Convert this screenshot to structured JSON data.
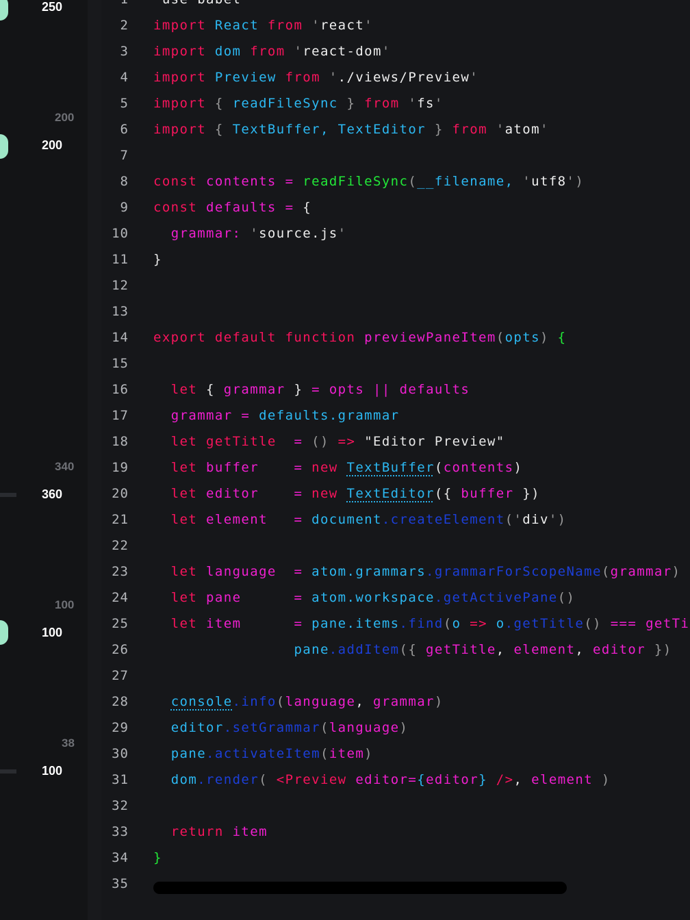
{
  "sidebar": {
    "values": [
      {
        "top": "250",
        "top_dim": ""
      },
      {
        "top": "200",
        "top_dim": "200"
      },
      {
        "top": "360",
        "top_dim": "340"
      },
      {
        "top": "100",
        "top_dim": "100"
      },
      {
        "top": "100",
        "top_dim": "38"
      }
    ]
  },
  "editor": {
    "lines": [
      {
        "n": "1",
        "tokens": [
          [
            "q",
            "'"
          ],
          [
            "str",
            "use babel"
          ],
          [
            "q",
            "'"
          ]
        ]
      },
      {
        "n": "2",
        "tokens": [
          [
            "kw",
            "import "
          ],
          [
            "cls",
            "React "
          ],
          [
            "kw",
            "from "
          ],
          [
            "q",
            "'"
          ],
          [
            "str",
            "react"
          ],
          [
            "q",
            "'"
          ]
        ]
      },
      {
        "n": "3",
        "tokens": [
          [
            "kw",
            "import "
          ],
          [
            "cls",
            "dom "
          ],
          [
            "kw",
            "from "
          ],
          [
            "q",
            "'"
          ],
          [
            "str",
            "react-dom"
          ],
          [
            "q",
            "'"
          ]
        ]
      },
      {
        "n": "4",
        "tokens": [
          [
            "kw",
            "import "
          ],
          [
            "cls",
            "Preview "
          ],
          [
            "kw",
            "from "
          ],
          [
            "q",
            "'"
          ],
          [
            "str",
            "./views/Preview"
          ],
          [
            "q",
            "'"
          ]
        ]
      },
      {
        "n": "5",
        "tokens": [
          [
            "kw",
            "import "
          ],
          [
            "dim",
            "{ "
          ],
          [
            "cls",
            "readFileSync "
          ],
          [
            "dim",
            "} "
          ],
          [
            "kw",
            "from "
          ],
          [
            "q",
            "'"
          ],
          [
            "str",
            "fs"
          ],
          [
            "q",
            "'"
          ]
        ]
      },
      {
        "n": "6",
        "tokens": [
          [
            "kw",
            "import "
          ],
          [
            "dim",
            "{ "
          ],
          [
            "cls",
            "TextBuffer, TextEditor "
          ],
          [
            "dim",
            "} "
          ],
          [
            "kw",
            "from "
          ],
          [
            "q",
            "'"
          ],
          [
            "str",
            "atom"
          ],
          [
            "q",
            "'"
          ]
        ]
      },
      {
        "n": "7",
        "tokens": []
      },
      {
        "n": "8",
        "tokens": [
          [
            "kw",
            "const "
          ],
          [
            "id",
            "contents "
          ],
          [
            "op",
            "= "
          ],
          [
            "fn",
            "readFileSync"
          ],
          [
            "dim",
            "("
          ],
          [
            "prop",
            "__filename, "
          ],
          [
            "q",
            "'"
          ],
          [
            "str",
            "utf8"
          ],
          [
            "q",
            "'"
          ],
          [
            "dim",
            ")"
          ]
        ]
      },
      {
        "n": "9",
        "tokens": [
          [
            "kw",
            "const "
          ],
          [
            "id",
            "defaults "
          ],
          [
            "op",
            "= "
          ],
          [
            "w",
            "{"
          ]
        ]
      },
      {
        "n": "10",
        "tokens": [
          [
            "w",
            "  "
          ],
          [
            "id",
            "grammar: "
          ],
          [
            "q",
            "'"
          ],
          [
            "str",
            "source.js"
          ],
          [
            "q",
            "'"
          ]
        ]
      },
      {
        "n": "11",
        "tokens": [
          [
            "w",
            "}"
          ]
        ]
      },
      {
        "n": "12",
        "tokens": []
      },
      {
        "n": "13",
        "tokens": []
      },
      {
        "n": "14",
        "tokens": [
          [
            "kw",
            "export default function "
          ],
          [
            "id",
            "previewPaneItem"
          ],
          [
            "dim",
            "("
          ],
          [
            "prop",
            "opts"
          ],
          [
            "dim",
            ") "
          ],
          [
            "fn",
            "{"
          ]
        ]
      },
      {
        "n": "15",
        "tokens": []
      },
      {
        "n": "16",
        "tokens": [
          [
            "w",
            "  "
          ],
          [
            "kw",
            "let "
          ],
          [
            "w",
            "{ "
          ],
          [
            "id",
            "grammar "
          ],
          [
            "w",
            "} "
          ],
          [
            "op",
            "= "
          ],
          [
            "id",
            "opts "
          ],
          [
            "op",
            "|| "
          ],
          [
            "id",
            "defaults"
          ]
        ]
      },
      {
        "n": "17",
        "tokens": [
          [
            "w",
            "  "
          ],
          [
            "id",
            "grammar "
          ],
          [
            "op",
            "= "
          ],
          [
            "prop",
            "defaults"
          ],
          [
            "prop",
            ".grammar"
          ]
        ]
      },
      {
        "n": "18",
        "tokens": [
          [
            "w",
            "  "
          ],
          [
            "kw",
            "let "
          ],
          [
            "kw",
            "getTitle  "
          ],
          [
            "op",
            "= "
          ],
          [
            "dim",
            "() "
          ],
          [
            "kw",
            "=> "
          ],
          [
            "w",
            "\"Editor Preview\""
          ]
        ]
      },
      {
        "n": "19",
        "tokens": [
          [
            "w",
            "  "
          ],
          [
            "kw",
            "let "
          ],
          [
            "id",
            "buffer    "
          ],
          [
            "op",
            "= "
          ],
          [
            "kw",
            "new "
          ],
          [
            "cls_u",
            "TextBuffer"
          ],
          [
            "w",
            "("
          ],
          [
            "id",
            "contents"
          ],
          [
            "w",
            ")"
          ]
        ]
      },
      {
        "n": "20",
        "tokens": [
          [
            "w",
            "  "
          ],
          [
            "kw",
            "let "
          ],
          [
            "id",
            "editor    "
          ],
          [
            "op",
            "= "
          ],
          [
            "kw",
            "new "
          ],
          [
            "cls_u",
            "TextEditor"
          ],
          [
            "w",
            "({ "
          ],
          [
            "id",
            "buffer "
          ],
          [
            "w",
            "})"
          ]
        ]
      },
      {
        "n": "21",
        "tokens": [
          [
            "w",
            "  "
          ],
          [
            "kw",
            "let "
          ],
          [
            "id",
            "element   "
          ],
          [
            "op",
            "= "
          ],
          [
            "prop",
            "document"
          ],
          [
            "meth",
            ".createElement"
          ],
          [
            "dim",
            "("
          ],
          [
            "q",
            "'"
          ],
          [
            "str",
            "div"
          ],
          [
            "q",
            "'"
          ],
          [
            "dim",
            ")"
          ]
        ]
      },
      {
        "n": "22",
        "tokens": []
      },
      {
        "n": "23",
        "tokens": [
          [
            "w",
            "  "
          ],
          [
            "kw",
            "let "
          ],
          [
            "id",
            "language  "
          ],
          [
            "op",
            "= "
          ],
          [
            "prop",
            "atom.grammars"
          ],
          [
            "meth",
            ".grammarForScopeName"
          ],
          [
            "dim",
            "("
          ],
          [
            "id",
            "grammar"
          ],
          [
            "dim",
            ")"
          ]
        ]
      },
      {
        "n": "24",
        "tokens": [
          [
            "w",
            "  "
          ],
          [
            "kw",
            "let "
          ],
          [
            "id",
            "pane      "
          ],
          [
            "op",
            "= "
          ],
          [
            "prop",
            "atom.workspace"
          ],
          [
            "meth",
            ".getActivePane"
          ],
          [
            "dim",
            "()"
          ]
        ]
      },
      {
        "n": "25",
        "tokens": [
          [
            "w",
            "  "
          ],
          [
            "kw",
            "let "
          ],
          [
            "id",
            "item      "
          ],
          [
            "op",
            "= "
          ],
          [
            "prop",
            "pane.items"
          ],
          [
            "meth",
            ".find"
          ],
          [
            "dim",
            "("
          ],
          [
            "prop",
            "o "
          ],
          [
            "kw",
            "=> "
          ],
          [
            "prop",
            "o"
          ],
          [
            "meth",
            ".getTitle"
          ],
          [
            "dim",
            "() "
          ],
          [
            "op",
            "=== "
          ],
          [
            "id",
            "getTitle"
          ],
          [
            "dim",
            "())"
          ]
        ]
      },
      {
        "n": "26",
        "tokens": [
          [
            "w",
            "                "
          ],
          [
            "prop",
            "pane"
          ],
          [
            "meth",
            ".addItem"
          ],
          [
            "dim",
            "({ "
          ],
          [
            "id",
            "getTitle"
          ],
          [
            "w",
            ", "
          ],
          [
            "id",
            "element"
          ],
          [
            "w",
            ", "
          ],
          [
            "id",
            "editor "
          ],
          [
            "dim",
            "})"
          ]
        ]
      },
      {
        "n": "27",
        "tokens": []
      },
      {
        "n": "28",
        "tokens": [
          [
            "w",
            "  "
          ],
          [
            "prop_u",
            "console"
          ],
          [
            "meth",
            ".info"
          ],
          [
            "dim",
            "("
          ],
          [
            "id",
            "language"
          ],
          [
            "w",
            ", "
          ],
          [
            "id",
            "grammar"
          ],
          [
            "dim",
            ")"
          ]
        ]
      },
      {
        "n": "29",
        "tokens": [
          [
            "w",
            "  "
          ],
          [
            "prop",
            "editor"
          ],
          [
            "meth",
            ".setGrammar"
          ],
          [
            "dim",
            "("
          ],
          [
            "id",
            "language"
          ],
          [
            "dim",
            ")"
          ]
        ]
      },
      {
        "n": "30",
        "tokens": [
          [
            "w",
            "  "
          ],
          [
            "prop",
            "pane"
          ],
          [
            "meth",
            ".activateItem"
          ],
          [
            "dim",
            "("
          ],
          [
            "id",
            "item"
          ],
          [
            "dim",
            ")"
          ]
        ]
      },
      {
        "n": "31",
        "tokens": [
          [
            "w",
            "  "
          ],
          [
            "prop",
            "dom"
          ],
          [
            "meth",
            ".render"
          ],
          [
            "dim",
            "( "
          ],
          [
            "kw",
            "<Preview "
          ],
          [
            "id",
            "editor="
          ],
          [
            "prop",
            "{"
          ],
          [
            "id",
            "editor"
          ],
          [
            "prop",
            "} "
          ],
          [
            "kw",
            "/>"
          ],
          [
            "w",
            ", "
          ],
          [
            "id",
            "element "
          ],
          [
            "dim",
            ")"
          ]
        ]
      },
      {
        "n": "32",
        "tokens": []
      },
      {
        "n": "33",
        "tokens": [
          [
            "w",
            "  "
          ],
          [
            "kw",
            "return "
          ],
          [
            "id",
            "item"
          ]
        ]
      },
      {
        "n": "34",
        "tokens": [
          [
            "fn",
            "}"
          ]
        ]
      },
      {
        "n": "35",
        "tokens": []
      }
    ]
  }
}
